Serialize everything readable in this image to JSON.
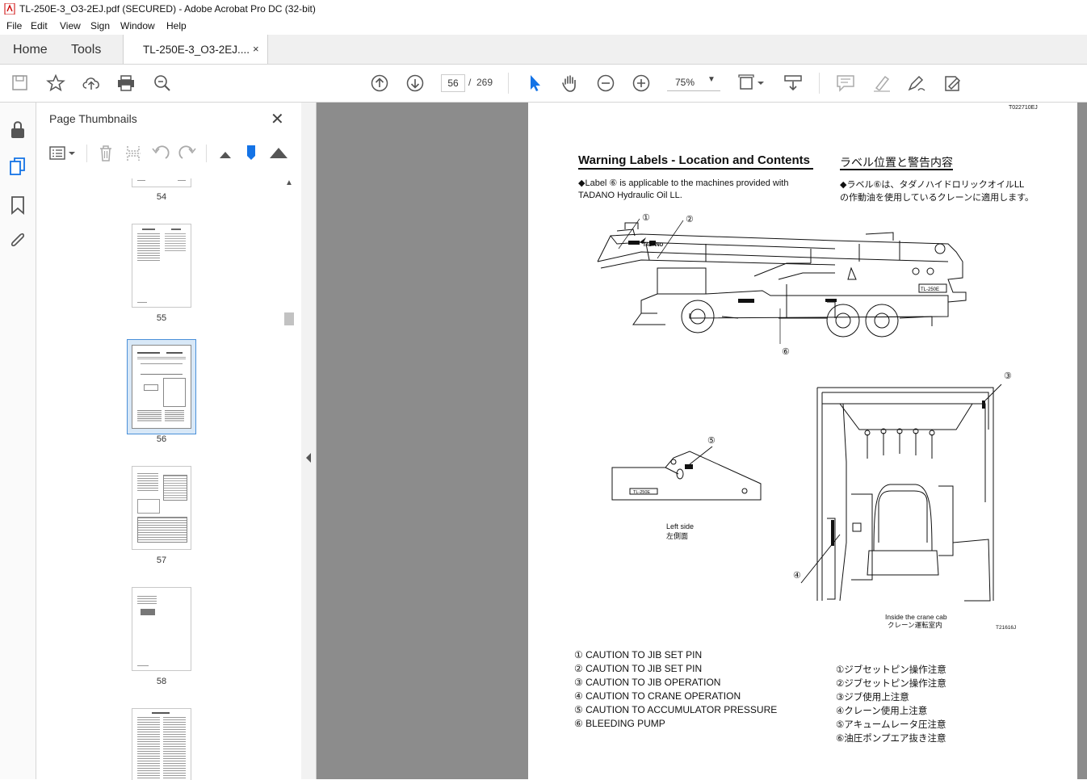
{
  "window": {
    "title": "TL-250E-3_O3-2EJ.pdf (SECURED) - Adobe Acrobat Pro DC (32-bit)"
  },
  "menu": [
    "File",
    "Edit",
    "View",
    "Sign",
    "Window",
    "Help"
  ],
  "nav": {
    "home": "Home",
    "tools": "Tools",
    "doc_tab": "TL-250E-3_O3-2EJ....",
    "close": "×"
  },
  "toolbar": {
    "page_current": "56",
    "page_sep": "/",
    "page_total": "269",
    "zoom": "75%"
  },
  "thumbnails": {
    "title": "Page Thumbnails",
    "close": "✕",
    "pages": [
      "54",
      "55",
      "56",
      "57",
      "58"
    ],
    "selected": "56"
  },
  "document": {
    "doc_code": "T022710EJ",
    "heading_en": "Warning Labels - Location and Contents",
    "heading_jp": "ラベル位置と警告内容",
    "note_en_1": "◆Label ⑥ is applicable to the machines provided with",
    "note_en_2": "TADANO Hydraulic Oil LL.",
    "note_jp_1": "◆ラベル⑥は、タダノハイドロリックオイルLL",
    "note_jp_2": "の作動油を使用しているクレーンに適用します。",
    "callouts": [
      "①",
      "②",
      "③",
      "④",
      "⑤",
      "⑥"
    ],
    "crane_plate": "TL-250E",
    "left_side_en": "Left side",
    "left_side_jp": "左側面",
    "cab_en": "Inside the crane cab",
    "cab_jp": "クレーン運転室内",
    "fig_code": "T21616J",
    "labels_en": [
      "① CAUTION TO JIB SET PIN",
      "② CAUTION TO JIB SET PIN",
      "③ CAUTION TO JIB OPERATION",
      "④ CAUTION TO CRANE OPERATION",
      "⑤ CAUTION TO ACCUMULATOR PRESSURE",
      "⑥ BLEEDING PUMP"
    ],
    "labels_jp": [
      "①ジブセットピン操作注意",
      "②ジブセットピン操作注意",
      "③ジブ使用上注意",
      "④クレーン使用上注意",
      "⑤アキュームレータ圧注意",
      "⑥油圧ポンプエア抜き注意"
    ]
  }
}
